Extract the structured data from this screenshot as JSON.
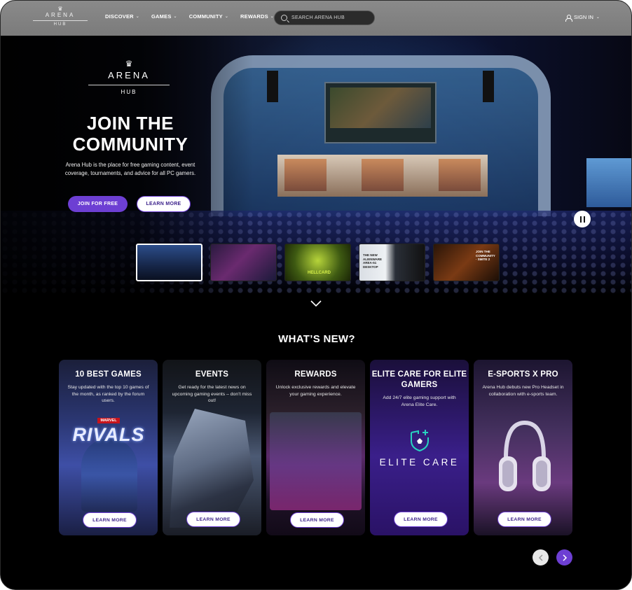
{
  "brand": {
    "name": "ARENA",
    "sub": "HUB"
  },
  "nav": {
    "items": [
      {
        "label": "DISCOVER"
      },
      {
        "label": "GAMES"
      },
      {
        "label": "COMMUNITY"
      },
      {
        "label": "REWARDS"
      }
    ],
    "search_placeholder": "SEARCH ARENA HUB",
    "signin_label": "SIGN IN"
  },
  "hero": {
    "title": "JOIN THE COMMUNITY",
    "description": "Arena Hub is the place for free gaming content, event coverage, tournaments, and advice for all PC gamers.",
    "join_label": "JOIN FOR FREE",
    "learn_label": "LEARN MORE",
    "thumbnails": [
      {
        "name": "arena-stage",
        "text": ""
      },
      {
        "name": "heroes-lineup",
        "text": ""
      },
      {
        "name": "hellcard",
        "text": "HELLCARD"
      },
      {
        "name": "desktop",
        "text": "THE NEW ALIENWARE AREA-51 DESKTOP"
      },
      {
        "name": "smite",
        "text": "JOIN THE COMMUNITY · SMITE 2"
      }
    ]
  },
  "whats_new": {
    "title": "WHAT’S NEW?",
    "cards": [
      {
        "title": "10 BEST GAMES",
        "desc": "Stay updated with the top 10 games of the month, as ranked by the forum users.",
        "button": "LEARN MORE",
        "art_text_1": "MARVEL",
        "art_text_2": "RIVALS"
      },
      {
        "title": "EVENTS",
        "desc": "Get ready for the latest news on upcoming gaming events – don’t miss out!",
        "button": "LEARN MORE"
      },
      {
        "title": "REWARDS",
        "desc": "Unlock exclusive rewards and elevate your gaming experience.",
        "button": "LEARN MORE"
      },
      {
        "title": "ELITE CARE FOR ELITE GAMERS",
        "desc": "Add 24/7 elite gaming support with Arena Elite Care.",
        "button": "LEARN MORE",
        "art_text_1": "ELITE CARE"
      },
      {
        "title": "E-SPORTS X PRO",
        "desc": "Arena Hub debuts new Pro Headset in collaboration with e-sports team.",
        "button": "LEARN MORE"
      }
    ]
  },
  "colors": {
    "accent": "#6d3fd3",
    "nav_bg": "#7f7f7f",
    "page_bg": "#000000"
  },
  "icons": [
    "crown-icon",
    "chevron-down-icon",
    "search-icon",
    "user-icon",
    "pause-icon",
    "chevron-left-icon",
    "chevron-right-icon",
    "shield-plus-icon"
  ]
}
